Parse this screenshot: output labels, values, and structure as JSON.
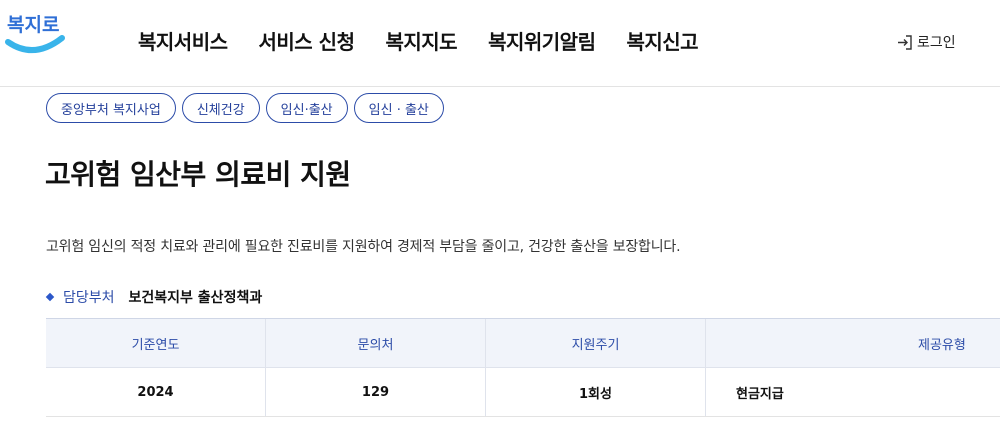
{
  "header": {
    "logo_text": "복지로",
    "nav": [
      "복지서비스",
      "서비스 신청",
      "복지지도",
      "복지위기알림",
      "복지신고"
    ],
    "login_label": "로그인"
  },
  "tags": [
    "중앙부처 복지사업",
    "신체건강",
    "임신·출산",
    "임신 · 출산"
  ],
  "page_title": "고위험 임산부 의료비 지원",
  "description": "고위험 임신의 적정 치료와 관리에 필요한 진료비를 지원하여 경제적 부담을 줄이고, 건강한 출산을 보장합니다.",
  "department": {
    "label": "담당부처",
    "value": "보건복지부 출산정책과"
  },
  "info_table": {
    "headers": [
      "기준연도",
      "문의처",
      "지원주기",
      "제공유형"
    ],
    "values": [
      "2024",
      "129",
      "1회성",
      "현금지급"
    ]
  },
  "colors": {
    "accent": "#2c4ca8",
    "logo": "#2f6fd6",
    "table_header_bg": "#f1f4fa"
  }
}
